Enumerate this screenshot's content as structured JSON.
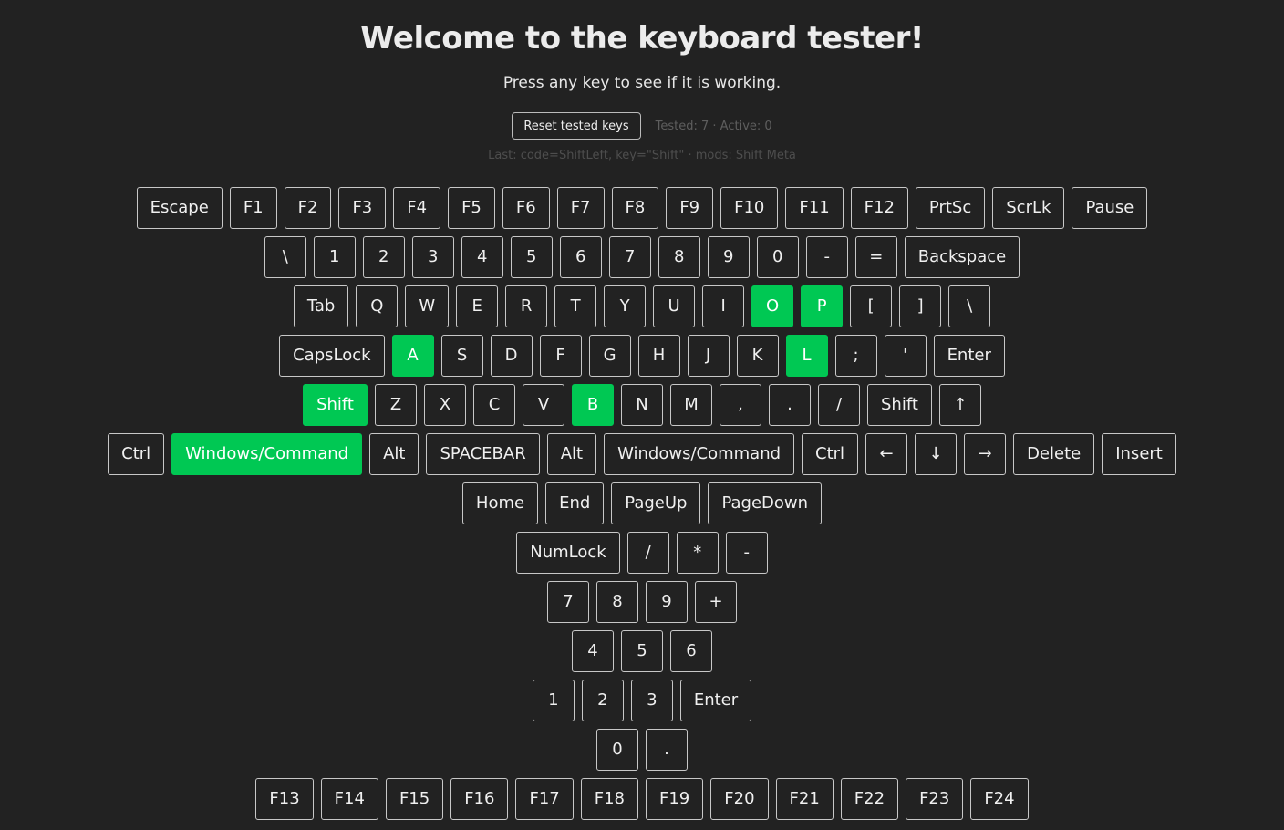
{
  "header": {
    "title": "Welcome to the keyboard tester!",
    "subtitle": "Press any key to see if it is working."
  },
  "controls": {
    "reset_label": "Reset tested keys",
    "counts_text": "Tested: 7 · Active: 0"
  },
  "status": {
    "last_text": "Last: code=ShiftLeft, key=\"Shift\" · mods: Shift Meta"
  },
  "colors": {
    "background": "#222222",
    "tested": "#00c853",
    "key_border": "#c8c8c8"
  },
  "keyboard": {
    "rows": [
      [
        {
          "label": "Escape"
        },
        {
          "label": "F1"
        },
        {
          "label": "F2"
        },
        {
          "label": "F3"
        },
        {
          "label": "F4"
        },
        {
          "label": "F5"
        },
        {
          "label": "F6"
        },
        {
          "label": "F7"
        },
        {
          "label": "F8"
        },
        {
          "label": "F9"
        },
        {
          "label": "F10"
        },
        {
          "label": "F11"
        },
        {
          "label": "F12"
        },
        {
          "label": "PrtSc"
        },
        {
          "label": "ScrLk"
        },
        {
          "label": "Pause"
        }
      ],
      [
        {
          "label": "\\"
        },
        {
          "label": "1"
        },
        {
          "label": "2"
        },
        {
          "label": "3"
        },
        {
          "label": "4"
        },
        {
          "label": "5"
        },
        {
          "label": "6"
        },
        {
          "label": "7"
        },
        {
          "label": "8"
        },
        {
          "label": "9"
        },
        {
          "label": "0"
        },
        {
          "label": "-"
        },
        {
          "label": "="
        },
        {
          "label": "Backspace"
        }
      ],
      [
        {
          "label": "Tab"
        },
        {
          "label": "Q"
        },
        {
          "label": "W"
        },
        {
          "label": "E"
        },
        {
          "label": "R"
        },
        {
          "label": "T"
        },
        {
          "label": "Y"
        },
        {
          "label": "U"
        },
        {
          "label": "I"
        },
        {
          "label": "O",
          "tested": true
        },
        {
          "label": "P",
          "tested": true
        },
        {
          "label": "["
        },
        {
          "label": "]"
        },
        {
          "label": "\\"
        }
      ],
      [
        {
          "label": "CapsLock"
        },
        {
          "label": "A",
          "tested": true
        },
        {
          "label": "S"
        },
        {
          "label": "D"
        },
        {
          "label": "F"
        },
        {
          "label": "G"
        },
        {
          "label": "H"
        },
        {
          "label": "J"
        },
        {
          "label": "K"
        },
        {
          "label": "L",
          "tested": true
        },
        {
          "label": ";"
        },
        {
          "label": "'"
        },
        {
          "label": "Enter"
        }
      ],
      [
        {
          "label": "Shift",
          "tested": true
        },
        {
          "label": "Z"
        },
        {
          "label": "X"
        },
        {
          "label": "C"
        },
        {
          "label": "V"
        },
        {
          "label": "B",
          "tested": true
        },
        {
          "label": "N"
        },
        {
          "label": "M"
        },
        {
          "label": ","
        },
        {
          "label": "."
        },
        {
          "label": "/"
        },
        {
          "label": "Shift"
        },
        {
          "label": "↑"
        }
      ],
      [
        {
          "label": "Ctrl"
        },
        {
          "label": "Windows/Command",
          "tested": true
        },
        {
          "label": "Alt"
        },
        {
          "label": "SPACEBAR"
        },
        {
          "label": "Alt"
        },
        {
          "label": "Windows/Command"
        },
        {
          "label": "Ctrl"
        },
        {
          "label": "←"
        },
        {
          "label": "↓"
        },
        {
          "label": "→"
        },
        {
          "label": "Delete"
        },
        {
          "label": "Insert"
        }
      ],
      [
        {
          "label": "Home"
        },
        {
          "label": "End"
        },
        {
          "label": "PageUp"
        },
        {
          "label": "PageDown"
        }
      ],
      [
        {
          "label": "NumLock"
        },
        {
          "label": "/"
        },
        {
          "label": "*"
        },
        {
          "label": "-"
        }
      ],
      [
        {
          "label": "7"
        },
        {
          "label": "8"
        },
        {
          "label": "9"
        },
        {
          "label": "+"
        }
      ],
      [
        {
          "label": "4"
        },
        {
          "label": "5"
        },
        {
          "label": "6"
        }
      ],
      [
        {
          "label": "1"
        },
        {
          "label": "2"
        },
        {
          "label": "3"
        },
        {
          "label": "Enter"
        }
      ],
      [
        {
          "label": "0"
        },
        {
          "label": "."
        }
      ],
      [
        {
          "label": "F13"
        },
        {
          "label": "F14"
        },
        {
          "label": "F15"
        },
        {
          "label": "F16"
        },
        {
          "label": "F17"
        },
        {
          "label": "F18"
        },
        {
          "label": "F19"
        },
        {
          "label": "F20"
        },
        {
          "label": "F21"
        },
        {
          "label": "F22"
        },
        {
          "label": "F23"
        },
        {
          "label": "F24"
        }
      ]
    ]
  }
}
